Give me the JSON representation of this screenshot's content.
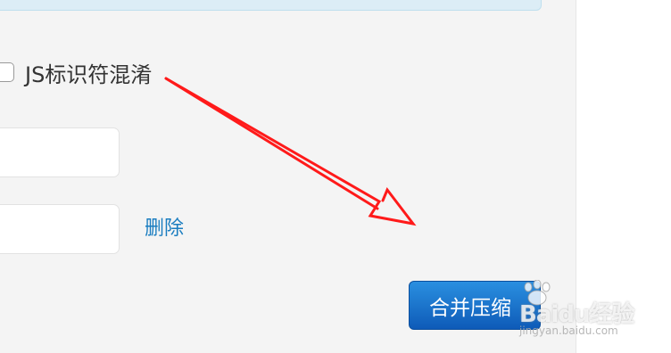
{
  "options": {
    "js_obfuscate_label": "JS标识符混淆",
    "js_obfuscate_checked": false
  },
  "file_list": {
    "delete_label": "删除"
  },
  "actions": {
    "merge_compress_label": "合并压缩"
  },
  "watermark": {
    "brand": "Baidu经验",
    "url": "jingyan.baidu.com"
  },
  "colors": {
    "accent_link": "#1a7dc0",
    "button_primary": "#1565c0",
    "annotation_arrow": "#ff0000"
  }
}
